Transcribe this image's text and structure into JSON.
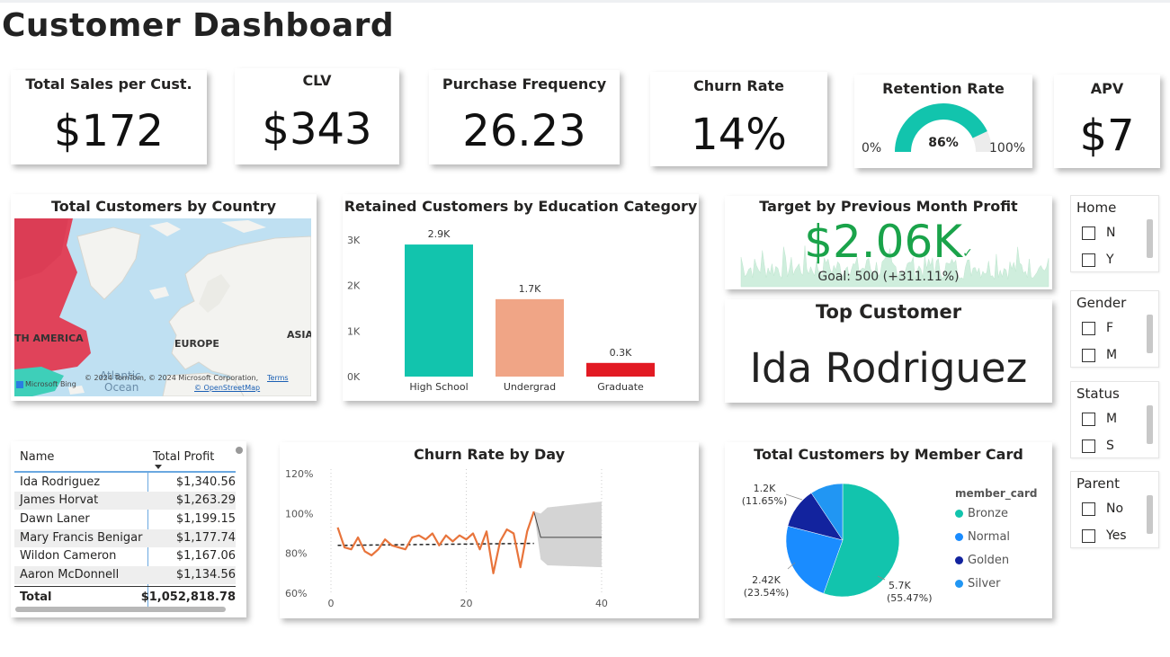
{
  "page": {
    "title": "Customer Dashboard"
  },
  "kpis": {
    "total_sales": {
      "title": "Total Sales per Cust.",
      "value": "$172"
    },
    "clv": {
      "title": "CLV",
      "value": "$343"
    },
    "purchase_frequency": {
      "title": "Purchase Frequency",
      "value": "26.23"
    },
    "churn_rate": {
      "title": "Churn Rate",
      "value": "14%"
    },
    "retention_rate": {
      "title": "Retention Rate",
      "value": "86%",
      "min_label": "0%",
      "max_label": "100%",
      "fraction": 0.86,
      "color": "#12c4ad"
    },
    "apv": {
      "title": "APV",
      "value": "$7"
    }
  },
  "map": {
    "title": "Total Customers by Country",
    "labels": {
      "america": "TH AMERICA",
      "europe": "EUROPE",
      "asia": "ASIA",
      "atlantic": "Atlantic",
      "ocean": "Ocean"
    },
    "attribution": "© 2024 TomTom, © 2024 Microsoft Corporation,",
    "terms": "Terms",
    "osm": "© OpenStreetMap",
    "bing": "Microsoft Bing",
    "highlight_color": "#e0435a"
  },
  "education_chart": {
    "title": "Retained Customers by Education Category",
    "chart_data": {
      "type": "bar",
      "categories": [
        "High School",
        "Undergrad",
        "Graduate"
      ],
      "values": [
        2900,
        1700,
        300
      ],
      "data_labels": [
        "2.9K",
        "1.7K",
        "0.3K"
      ],
      "colors": [
        "#12c4ad",
        "#f0a586",
        "#e21a23"
      ],
      "yticks": [
        "0K",
        "1K",
        "2K",
        "3K"
      ],
      "ylim": [
        0,
        3000
      ]
    }
  },
  "target": {
    "title": "Target by Previous Month Profit",
    "value": "$2.06K",
    "check": "✓",
    "goal": "Goal: 500 (+311.11%)",
    "color": "#1aa34a"
  },
  "top_customer": {
    "title": "Top Customer",
    "name": "Ida Rodriguez"
  },
  "slicers": [
    {
      "title": "Home",
      "options": [
        "N",
        "Y"
      ]
    },
    {
      "title": "Gender",
      "options": [
        "F",
        "M"
      ]
    },
    {
      "title": "Status",
      "options": [
        "M",
        "S"
      ]
    },
    {
      "title": "Parent",
      "options": [
        "No",
        "Yes"
      ]
    }
  ],
  "profit_table": {
    "headers": {
      "name": "Name",
      "profit": "Total Profit"
    },
    "rows": [
      {
        "name": "Ida Rodriguez",
        "profit": "$1,340.56"
      },
      {
        "name": "James Horvat",
        "profit": "$1,263.29"
      },
      {
        "name": "Dawn Laner",
        "profit": "$1,199.15"
      },
      {
        "name": "Mary Francis Benigar",
        "profit": "$1,177.74"
      },
      {
        "name": "Wildon Cameron",
        "profit": "$1,167.06"
      },
      {
        "name": "Aaron McDonnell",
        "profit": "$1,134.56"
      }
    ],
    "total_label": "Total",
    "total_value": "$1,052,818.78"
  },
  "churn_day_chart": {
    "title": "Churn Rate by Day",
    "chart_data": {
      "type": "line",
      "x": [
        1,
        2,
        3,
        4,
        5,
        6,
        7,
        8,
        9,
        10,
        11,
        12,
        13,
        14,
        15,
        16,
        17,
        18,
        19,
        20,
        21,
        22,
        23,
        24,
        25,
        26,
        27,
        28,
        29,
        30
      ],
      "values": [
        93,
        83,
        82,
        88,
        81,
        79,
        82,
        87,
        84,
        83,
        82,
        88,
        89,
        87,
        90,
        84,
        89,
        86,
        89,
        87,
        90,
        82,
        91,
        70,
        86,
        92,
        90,
        73,
        91,
        101
      ],
      "trend": [
        84,
        85
      ],
      "forecast_x": [
        30,
        31,
        32,
        40
      ],
      "forecast_values": [
        101,
        88,
        88,
        88
      ],
      "forecast_upper": [
        101,
        100,
        103,
        106
      ],
      "forecast_lower": [
        101,
        77,
        74,
        73
      ],
      "yticks": [
        "60%",
        "80%",
        "100%",
        "120%"
      ],
      "ylim": [
        60,
        120
      ],
      "xticks": [
        "0",
        "20",
        "40"
      ],
      "xlim": [
        0,
        42
      ],
      "line_color": "#e8743b"
    }
  },
  "member_chart": {
    "title": "Total Customers by Member Card",
    "legend_title": "member_card",
    "chart_data": {
      "type": "pie",
      "categories": [
        "Bronze",
        "Normal",
        "Golden",
        "Silver"
      ],
      "values": [
        55.47,
        23.54,
        11.65,
        9.34
      ],
      "colors": [
        "#12c4ad",
        "#1a8cff",
        "#12239e",
        "#2196f3"
      ],
      "data_labels": [
        {
          "value": "5.7K",
          "pct": "(55.47%)"
        },
        {
          "value": "2.42K",
          "pct": "(23.54%)"
        },
        {
          "value": "1.2K",
          "pct": "(11.65%)"
        }
      ]
    }
  }
}
